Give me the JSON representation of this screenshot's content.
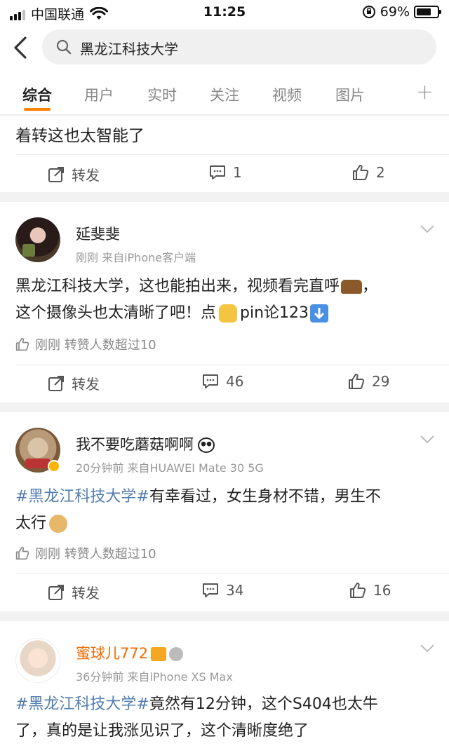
{
  "status": {
    "carrier": "中国联通",
    "time": "11:25",
    "battery": "69%",
    "battery_level": 0.69
  },
  "search": {
    "query": "黑龙江科技大学"
  },
  "tabs": [
    {
      "label": "综合"
    },
    {
      "label": "用户"
    },
    {
      "label": "实时"
    },
    {
      "label": "关注"
    },
    {
      "label": "视频"
    },
    {
      "label": "图片"
    }
  ],
  "tab_plus": "+",
  "post0": {
    "text_tail": "着转这也太智能了",
    "repost": "转发",
    "comments": "1",
    "likes": "2"
  },
  "post1": {
    "name": "延斐斐",
    "meta": "刚刚  来自iPhone客户端",
    "text_a": "黑龙江科技大学，这也能拍出来，视频看完直呼",
    "text_b": "这个摄像头也太清晰了吧！点",
    "text_c": "pin论123",
    "liked": "刚刚 转赞人数超过10",
    "repost": "转发",
    "comments": "46",
    "likes": "29"
  },
  "post2": {
    "name": "我不要吃蘑菇啊啊",
    "meta": "20分钟前  来自HUAWEI Mate 30 5G",
    "hashtag": "#黑龙江科技大学#",
    "text_a": "有幸看过，女生身材不错，男生不",
    "text_b": "太行",
    "liked": "刚刚 转赞人数超过10",
    "repost": "转发",
    "comments": "34",
    "likes": "16"
  },
  "post3": {
    "name": "蜜球儿772",
    "meta": "36分钟前  来自iPhone XS Max",
    "hashtag": "#黑龙江科技大学#",
    "text_a": "竟然有12分钟，这个S404也太牛",
    "text_b": "了，真的是让我涨见识了，这个清晰度绝了"
  }
}
